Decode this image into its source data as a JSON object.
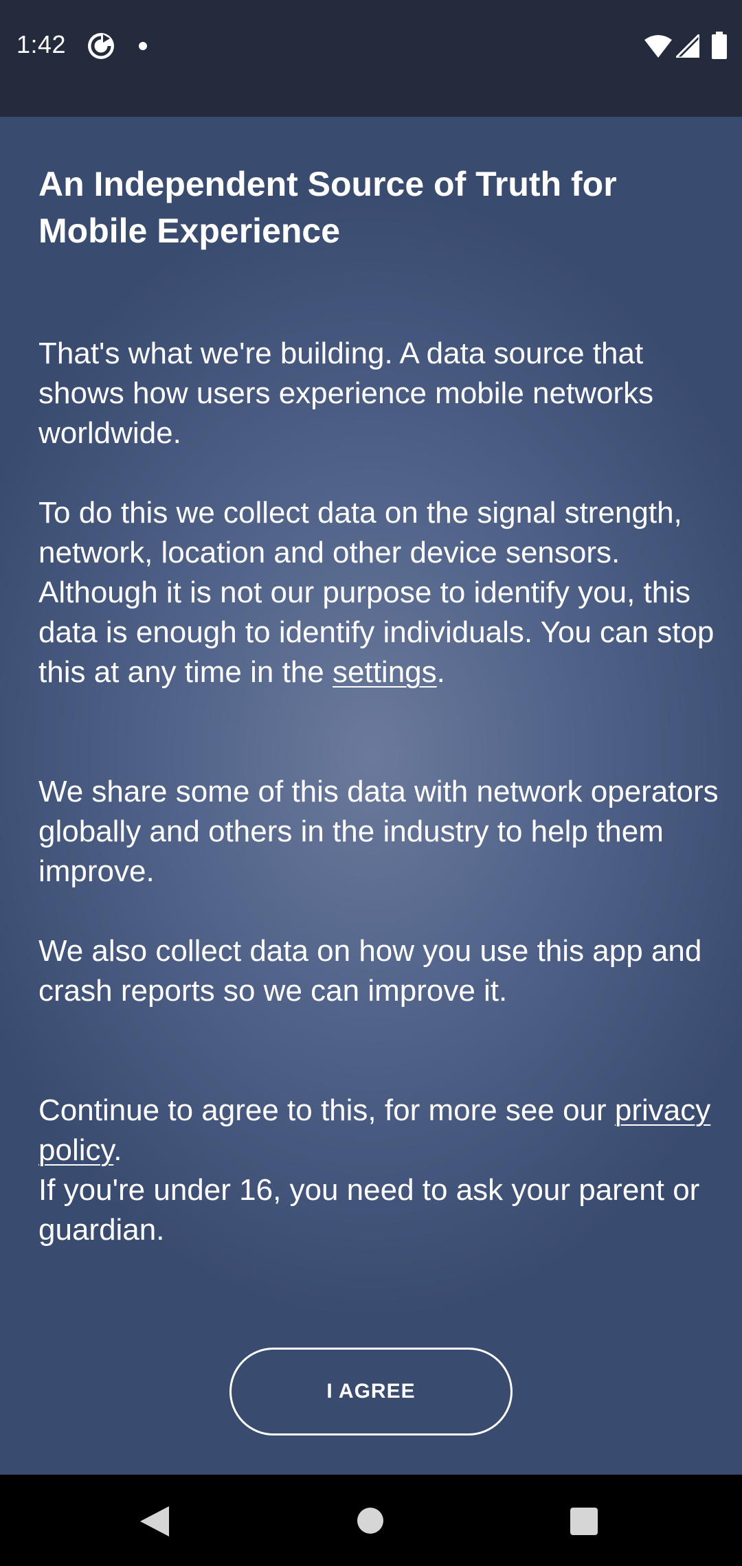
{
  "status_bar": {
    "time": "1:42",
    "icons": [
      "app-sync-icon",
      "notification-dot-icon",
      "wifi-icon",
      "signal-icon",
      "battery-icon"
    ]
  },
  "main": {
    "title": "An Independent Source of Truth for Mobile Experience",
    "p1": "That's what we're building. A data source that shows how users experience mobile networks worldwide.",
    "p2_text": "To do this we collect data on the signal strength, network, location and other device sensors. Although it is not our purpose to identify you, this data is enough to identify individuals. You can stop this at any time in the ",
    "p2_link": "settings",
    "p2_end": ".",
    "p3": "We share some of this data with network operators globally and others in the industry to help them improve.",
    "p4": "We also collect data on how you use this app and crash reports so we can improve it.",
    "p5_text": "Continue to agree to this, for more see our ",
    "p5_link": "privacy policy",
    "p5_end": ".",
    "p5_line2": "If you're under 16, you need to ask your parent or guardian.",
    "agree_label": "I AGREE"
  },
  "nav_bar": {
    "icons": [
      "back-icon",
      "home-icon",
      "recents-icon"
    ]
  },
  "colors": {
    "status_bar_bg": "#232b3d",
    "gradient_center": "#6b7a9c",
    "gradient_edge": "#3a4b70",
    "text": "#ffffff",
    "nav_bar_bg": "#000000"
  }
}
